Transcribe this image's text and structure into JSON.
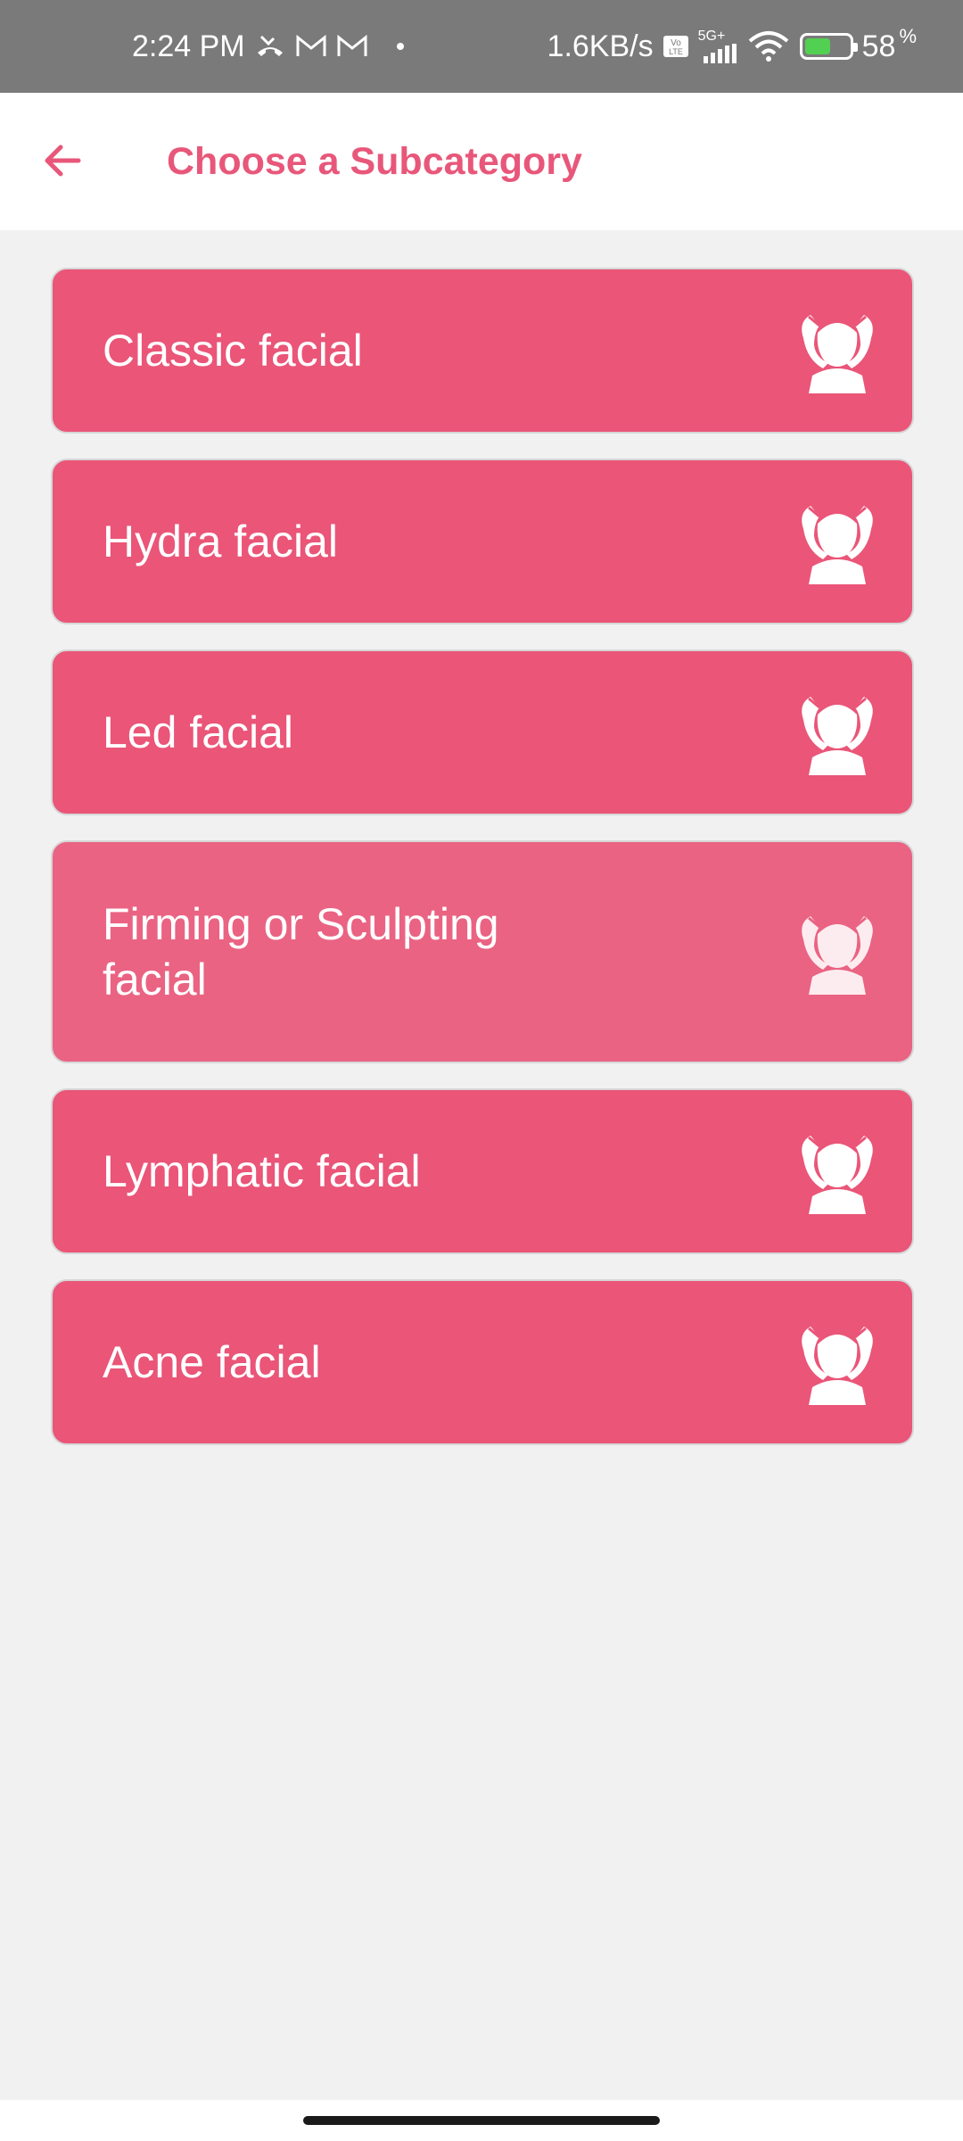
{
  "status_bar": {
    "time": "2:24 PM",
    "network_speed": "1.6KB/s",
    "network_type": "5G+",
    "battery_percent": "58",
    "battery_percent_sign": "%",
    "battery_level": 0.58,
    "icons": [
      "missed-call-icon",
      "gmail-icon",
      "gmail-icon",
      "volte-icon",
      "signal-icon",
      "wifi-icon",
      "battery-charging-icon"
    ]
  },
  "app_bar": {
    "title": "Choose a Subcategory",
    "accent_color": "#e8577a"
  },
  "subcategories": [
    {
      "label": "Classic facial",
      "icon": "facial-massage-icon"
    },
    {
      "label": "Hydra facial",
      "icon": "facial-massage-icon"
    },
    {
      "label": "Led facial",
      "icon": "facial-massage-icon"
    },
    {
      "label": "Firming or Sculpting facial",
      "icon": "facial-massage-icon"
    },
    {
      "label": "Lymphatic facial",
      "icon": "facial-massage-icon"
    },
    {
      "label": "Acne facial",
      "icon": "facial-massage-icon"
    }
  ],
  "colors": {
    "card_background": "#ea5578",
    "background": "#f1f1f1",
    "status_bar": "#7a7a7a"
  }
}
